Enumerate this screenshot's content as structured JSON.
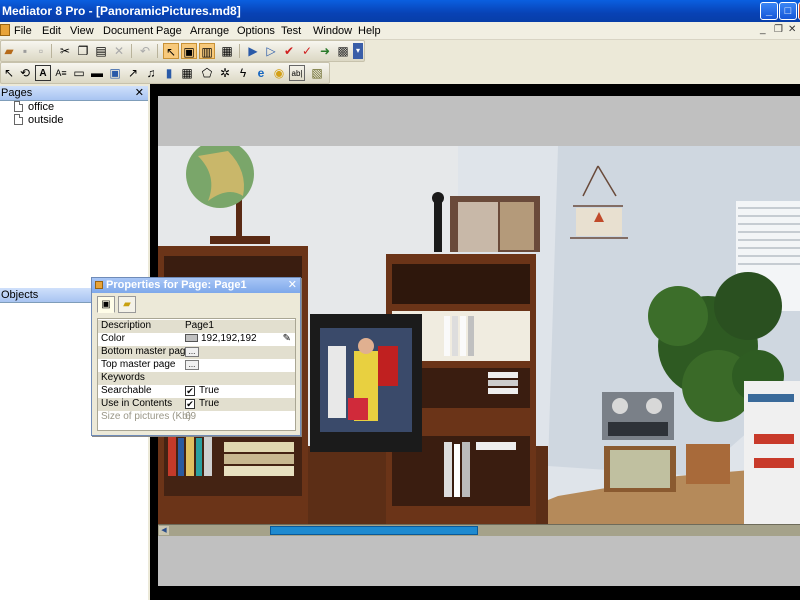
{
  "window": {
    "title": "Mediator 8 Pro - [PanoramicPictures.md8]",
    "minimize": "_",
    "maximize": "□",
    "close": "✕",
    "mdi_min": "_",
    "mdi_restore": "❐",
    "mdi_close": "✕"
  },
  "menu": [
    "File",
    "Edit",
    "View",
    "Document",
    "Page",
    "Arrange",
    "Options",
    "Test",
    "Window",
    "Help"
  ],
  "panels": {
    "pages_title": "Pages",
    "pages": [
      "office",
      "outside"
    ],
    "objects_title": "Objects",
    "close_glyph": "✕"
  },
  "dialog": {
    "title": "Properties for Page: Page1",
    "close_glyph": "✕",
    "rows": {
      "description_label": "Description",
      "description_value": "Page1",
      "color_label": "Color",
      "color_value": "192,192,192",
      "bottom_master_label": "Bottom master page",
      "top_master_label": "Top master page",
      "ellipsis": "...",
      "keywords_label": "Keywords",
      "searchable_label": "Searchable",
      "searchable_value": "True",
      "use_in_contents_label": "Use in Contents",
      "use_in_contents_value": "True",
      "size_label": "Size of pictures (Kb)",
      "size_value": "69"
    }
  },
  "colors": {
    "page_color": "#c0c0c0",
    "titlebar": "#0842b5",
    "scroll_thumb": "#1e8ad0"
  }
}
